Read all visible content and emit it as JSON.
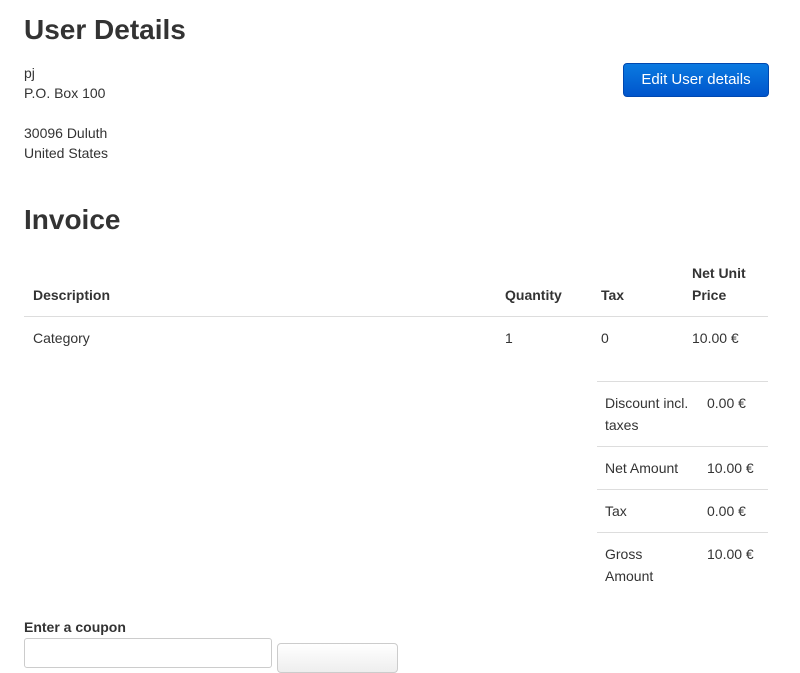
{
  "user_details": {
    "title": "User Details",
    "name": "pj",
    "address_line1": "P.O. Box 100",
    "city_line": "30096 Duluth",
    "country": "United States",
    "edit_button_label": "Edit User details"
  },
  "invoice": {
    "title": "Invoice",
    "columns": {
      "description": "Description",
      "quantity": "Quantity",
      "tax": "Tax",
      "net_unit_price_line1": "Net Unit",
      "net_unit_price_line2": "Price"
    },
    "rows": [
      {
        "description": "Category",
        "quantity": "1",
        "tax": "0",
        "net_unit_price": "10.00 €"
      }
    ],
    "totals": [
      {
        "label": "Discount incl. taxes",
        "value": "0.00 €"
      },
      {
        "label": "Net Amount",
        "value": "10.00 €"
      },
      {
        "label": "Tax",
        "value": "0.00 €"
      },
      {
        "label": "Gross Amount",
        "value": "10.00 €"
      }
    ]
  },
  "coupon": {
    "label": "Enter a coupon",
    "input_value": "",
    "button_label": ""
  },
  "colors": {
    "primary_button": "#0066dd",
    "text": "#333333",
    "divider": "#dddddd"
  }
}
